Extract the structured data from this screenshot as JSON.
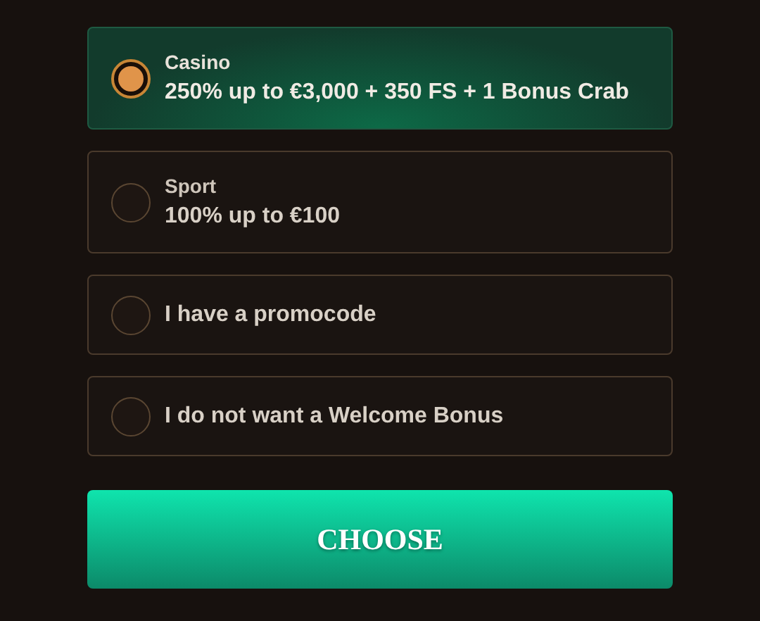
{
  "options": [
    {
      "caption": "Casino",
      "label": "250% up to €3,000 + 350 FS + 1 Bonus Crab",
      "selected": true
    },
    {
      "caption": "Sport",
      "label": "100% up to €100",
      "selected": false
    },
    {
      "label": "I have a promocode",
      "selected": false
    },
    {
      "label": "I do not want a Welcome Bonus",
      "selected": false
    }
  ],
  "button": {
    "label": "CHOOSE"
  }
}
